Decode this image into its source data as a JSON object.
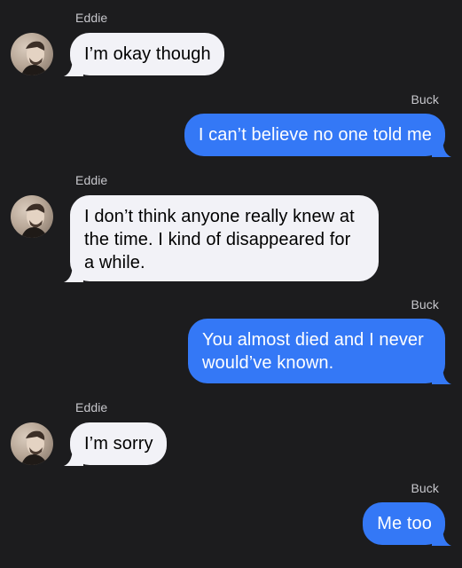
{
  "colors": {
    "background": "#1c1c1e",
    "incoming_bubble": "#f2f2f7",
    "outgoing_bubble": "#3478f6",
    "sender_label": "#c7c7cc"
  },
  "messages": [
    {
      "sender": "Eddie",
      "direction": "incoming",
      "text": "I’m okay though"
    },
    {
      "sender": "Buck",
      "direction": "outgoing",
      "text": "I can’t believe no one told me"
    },
    {
      "sender": "Eddie",
      "direction": "incoming",
      "text": "I don’t think anyone really knew at the time. I kind of disappeared for a while."
    },
    {
      "sender": "Buck",
      "direction": "outgoing",
      "text": "You almost died and I never would’ve known."
    },
    {
      "sender": "Eddie",
      "direction": "incoming",
      "text": "I’m sorry"
    },
    {
      "sender": "Buck",
      "direction": "outgoing",
      "text": "Me too"
    }
  ]
}
